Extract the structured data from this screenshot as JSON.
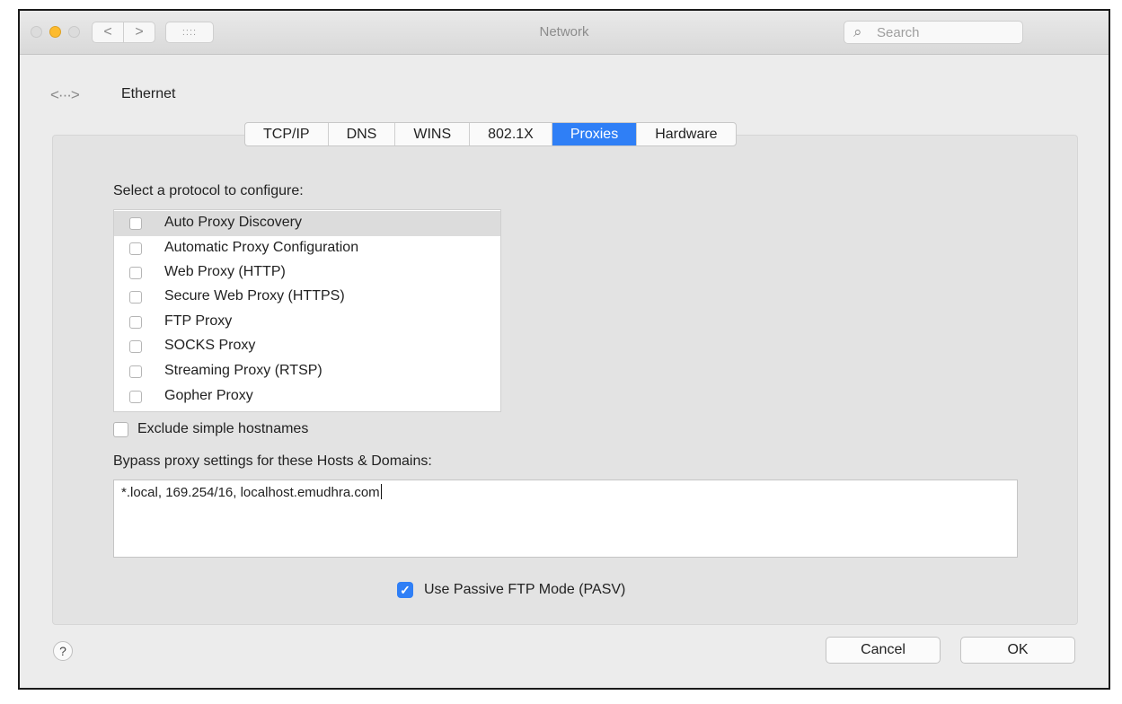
{
  "window": {
    "title": "Network",
    "search_placeholder": "Search",
    "nav_back": "<",
    "nav_forward": ">",
    "grid": "::::"
  },
  "header": {
    "icon": "<···>",
    "label": "Ethernet"
  },
  "tabs": [
    {
      "label": "TCP/IP",
      "active": false
    },
    {
      "label": "DNS",
      "active": false
    },
    {
      "label": "WINS",
      "active": false
    },
    {
      "label": "802.1X",
      "active": false
    },
    {
      "label": "Proxies",
      "active": true
    },
    {
      "label": "Hardware",
      "active": false
    }
  ],
  "proxies": {
    "select_label": "Select a protocol to configure:",
    "protocols": [
      {
        "label": "Auto Proxy Discovery",
        "checked": false,
        "selected": true
      },
      {
        "label": "Automatic Proxy Configuration",
        "checked": false,
        "selected": false
      },
      {
        "label": "Web Proxy (HTTP)",
        "checked": false,
        "selected": false
      },
      {
        "label": "Secure Web Proxy (HTTPS)",
        "checked": false,
        "selected": false
      },
      {
        "label": "FTP Proxy",
        "checked": false,
        "selected": false
      },
      {
        "label": "SOCKS Proxy",
        "checked": false,
        "selected": false
      },
      {
        "label": "Streaming Proxy (RTSP)",
        "checked": false,
        "selected": false
      },
      {
        "label": "Gopher Proxy",
        "checked": false,
        "selected": false
      }
    ],
    "exclude_label": "Exclude simple hostnames",
    "exclude_checked": false,
    "bypass_label": "Bypass proxy settings for these Hosts & Domains:",
    "bypass_value": "*.local, 169.254/16, localhost.emudhra.com",
    "pasv_label": "Use Passive FTP Mode (PASV)",
    "pasv_checked": true
  },
  "footer": {
    "help": "?",
    "cancel_label": "Cancel",
    "ok_label": "OK"
  },
  "colors": {
    "accent": "#2f7ff6"
  }
}
